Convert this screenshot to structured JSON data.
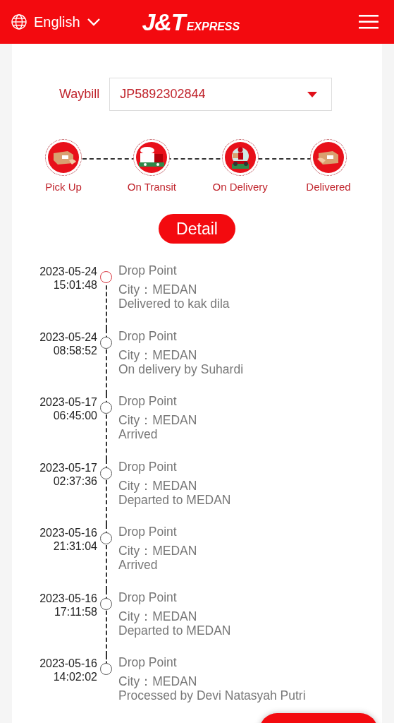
{
  "header": {
    "language": "English",
    "logo": {
      "mark": "J&T",
      "word": "EXPRESS"
    }
  },
  "waybill": {
    "label": "Waybill",
    "value": "JP5892302844"
  },
  "steps": [
    {
      "label": "Pick Up",
      "kind": "pickup"
    },
    {
      "label": "On Transit",
      "kind": "transit"
    },
    {
      "label": "On Delivery",
      "kind": "delivery"
    },
    {
      "label": "Delivered",
      "kind": "delivered"
    }
  ],
  "detail_button": "Detail",
  "events": [
    {
      "date": "2023-05-24",
      "time": "15:01:48",
      "title": "Drop Point",
      "city": "City：MEDAN",
      "note": "Delivered to kak dila",
      "current": true
    },
    {
      "date": "2023-05-24",
      "time": "08:58:52",
      "title": "Drop Point",
      "city": "City：MEDAN",
      "note": "On delivery by Suhardi",
      "current": false
    },
    {
      "date": "2023-05-17",
      "time": "06:45:00",
      "title": "Drop Point",
      "city": "City：MEDAN",
      "note": "Arrived",
      "current": false
    },
    {
      "date": "2023-05-17",
      "time": "02:37:36",
      "title": "Drop Point",
      "city": "City：MEDAN",
      "note": "Departed to MEDAN",
      "current": false
    },
    {
      "date": "2023-05-16",
      "time": "21:31:04",
      "title": "Drop Point",
      "city": "City：MEDAN",
      "note": "Arrived",
      "current": false
    },
    {
      "date": "2023-05-16",
      "time": "17:11:58",
      "title": "Drop Point",
      "city": "City：MEDAN",
      "note": "Departed to MEDAN",
      "current": false
    },
    {
      "date": "2023-05-16",
      "time": "14:02:02",
      "title": "Drop Point",
      "city": "City：MEDAN",
      "note": "Processed by Devi Natasyah Putri",
      "current": false
    }
  ]
}
